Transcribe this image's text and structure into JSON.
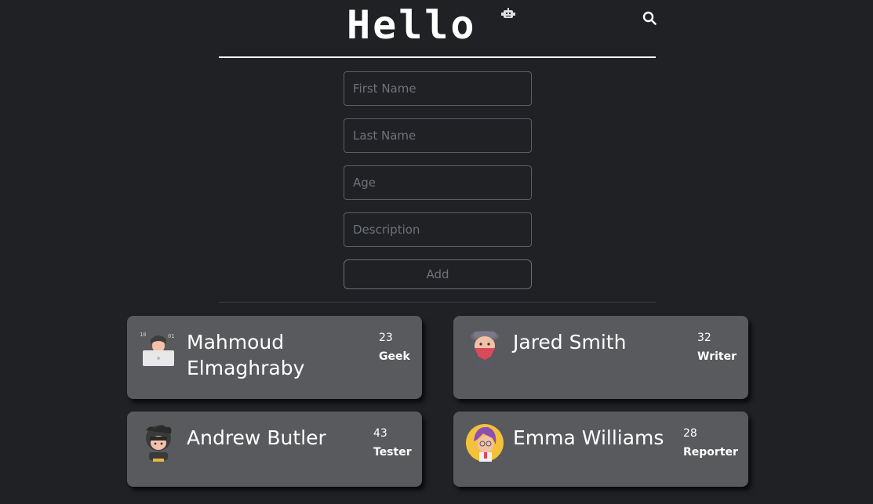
{
  "header": {
    "title": "Hello",
    "icons": {
      "logo": "robot-icon",
      "search": "search-icon"
    }
  },
  "form": {
    "first_name_placeholder": "First Name",
    "last_name_placeholder": "Last Name",
    "age_placeholder": "Age",
    "description_placeholder": "Description",
    "add_label": "Add"
  },
  "people": [
    {
      "name": "Mahmoud Elmaghraby",
      "age": "23",
      "role": "Geek",
      "avatar": "hacker-avatar"
    },
    {
      "name": "Jared Smith",
      "age": "32",
      "role": "Writer",
      "avatar": "bandit-avatar"
    },
    {
      "name": "Andrew Butler",
      "age": "43",
      "role": "Tester",
      "avatar": "ninja-avatar"
    },
    {
      "name": "Emma Williams",
      "age": "28",
      "role": "Reporter",
      "avatar": "woman-avatar"
    }
  ],
  "colors": {
    "background": "#1f2125",
    "card": "#585a5d",
    "input_border": "#5b5e63",
    "text": "#ffffff"
  }
}
